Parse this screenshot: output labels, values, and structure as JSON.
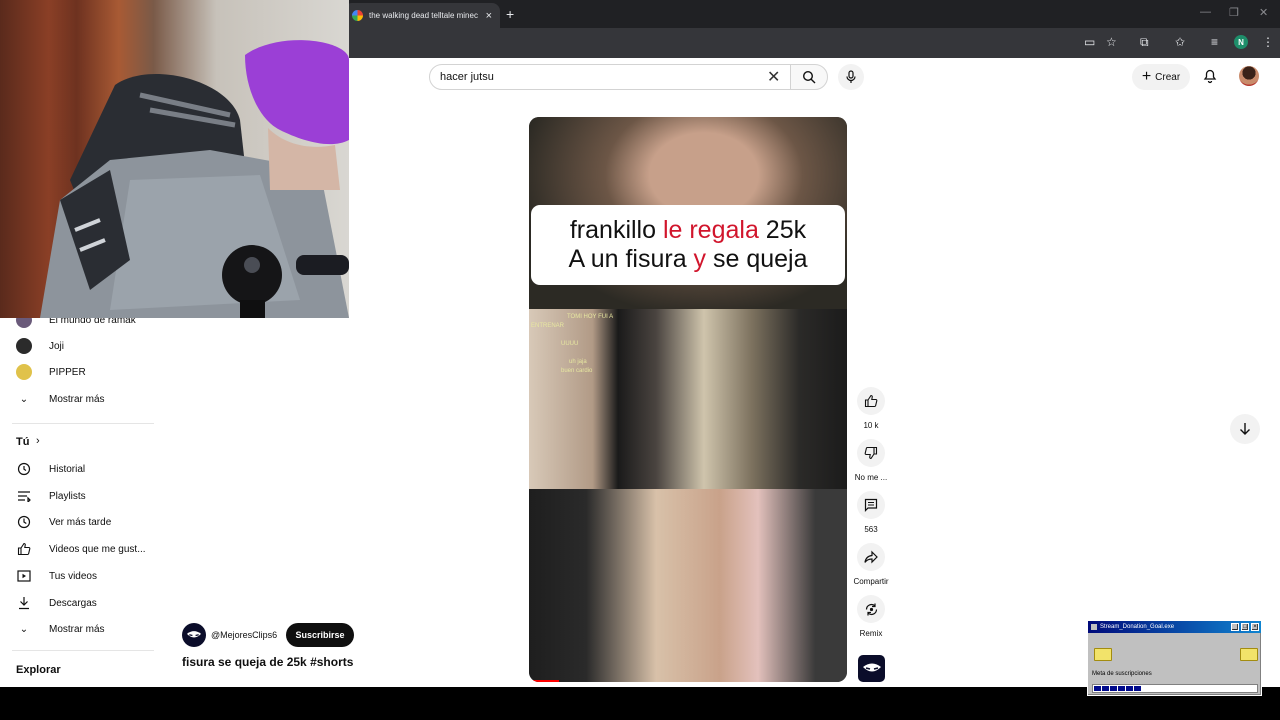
{
  "browser": {
    "tab_title": "the walking dead telltale minec",
    "profile_initial": "N"
  },
  "search": {
    "query": "hacer jutsu"
  },
  "header": {
    "create_label": "Crear"
  },
  "sidebar": {
    "subscriptions": [
      {
        "label": "El mundo de ramak",
        "color": "#6a5a7a"
      },
      {
        "label": "Joji",
        "color": "#2b2b2b"
      },
      {
        "label": "PIPPER",
        "color": "#e0c24a"
      }
    ],
    "show_more": "Mostrar más",
    "you_section": "Tú",
    "you_items": [
      {
        "label": "Historial",
        "icon": "history-icon"
      },
      {
        "label": "Playlists",
        "icon": "playlist-icon"
      },
      {
        "label": "Ver más tarde",
        "icon": "clock-icon"
      },
      {
        "label": "Videos que me gust...",
        "icon": "thumbs-up-icon"
      },
      {
        "label": "Tus videos",
        "icon": "video-icon"
      },
      {
        "label": "Descargas",
        "icon": "download-icon"
      }
    ],
    "show_more_2": "Mostrar más",
    "explore": "Explorar"
  },
  "short": {
    "caption_line1_a": "frankillo ",
    "caption_line1_b": "le regala",
    "caption_line1_c": " 25k",
    "caption_line2_a": "A un fisura ",
    "caption_line2_b": "y",
    "caption_line2_c": " se queja",
    "chat": [
      "TOMI HOY FUI A",
      "ENTRENAR",
      "UUUU",
      "uh jaja",
      "buen cardio"
    ],
    "title": "fisura se queja de 25k #shorts",
    "channel_handle": "@MejoresClips6",
    "subscribe_label": "Suscribirse"
  },
  "actions": {
    "likes": "10 k",
    "dislike": "No me ...",
    "comments": "563",
    "share": "Compartir",
    "remix": "Remix"
  },
  "overlay": {
    "goal_window_title": "Stream_Donation_Goal.exe",
    "goal_label": "Meta de suscripciones",
    "goal_progress": 0.28
  },
  "colors": {
    "caption_accent": "#d1152c",
    "progress": "#ff0000"
  }
}
